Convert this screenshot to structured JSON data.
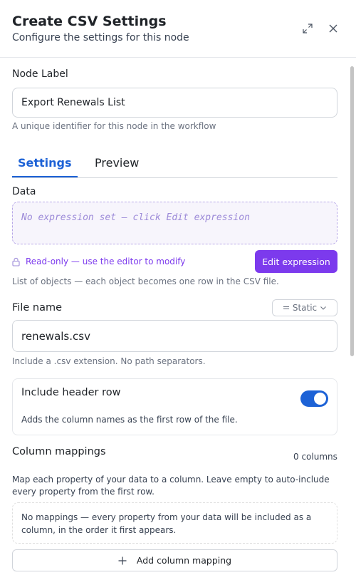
{
  "header": {
    "title": "Create CSV Settings",
    "subtitle": "Configure the settings for this node"
  },
  "node_label": {
    "label": "Node Label",
    "value": "Export Renewals List",
    "hint": "A unique identifier for this node in the workflow"
  },
  "tabs": [
    {
      "label": "Settings",
      "active": true
    },
    {
      "label": "Preview",
      "active": false
    }
  ],
  "data_field": {
    "label": "Data",
    "placeholder": "No expression set — click Edit expression",
    "readonly_text": "Read-only — use the editor to modify",
    "edit_button": "Edit expression",
    "hint": "List of objects — each object becomes one row in the CSV file."
  },
  "file_name": {
    "label": "File name",
    "mode": "Static",
    "value": "renewals.csv",
    "hint": "Include a .csv extension. No path separators."
  },
  "header_row": {
    "title": "Include header row",
    "description": "Adds the column names as the first row of the file.",
    "enabled": true
  },
  "column_mappings": {
    "label": "Column mappings",
    "count": "0 columns",
    "description": "Map each property of your data to a column. Leave empty to auto-include every property from the first row.",
    "empty_text": "No mappings — every property from your data will be included as a column, in the order it first appears.",
    "add_button": "Add column mapping"
  },
  "colors": {
    "accent_blue": "#1d62d6",
    "accent_purple": "#7c3aed"
  }
}
